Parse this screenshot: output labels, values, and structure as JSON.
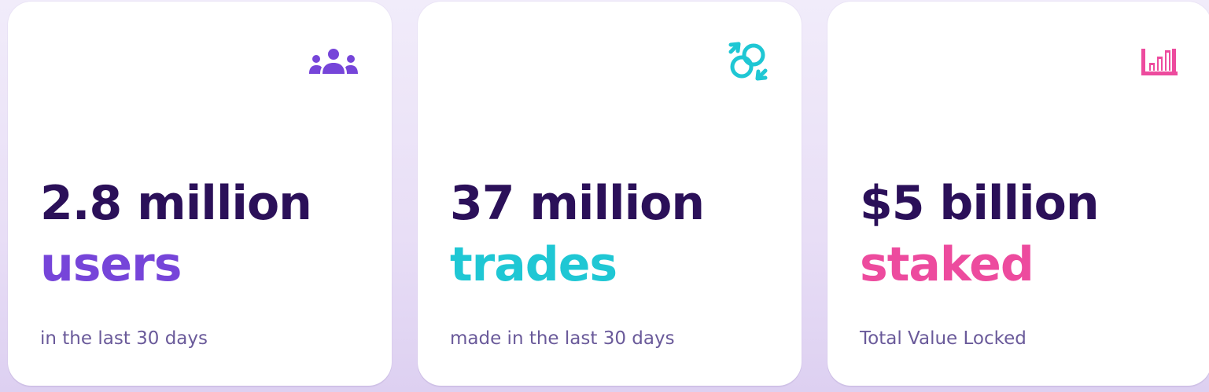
{
  "stats": [
    {
      "value": "2.8 million",
      "unit": "users",
      "caption": "in the last 30 days",
      "accent": "#7645d9",
      "icon": "users-icon"
    },
    {
      "value": "37 million",
      "unit": "trades",
      "caption": "made in the last 30 days",
      "accent": "#1fc7d4",
      "icon": "swap-icon"
    },
    {
      "value": "$5 billion",
      "unit": "staked",
      "caption": "Total Value Locked",
      "accent": "#ed4b9e",
      "icon": "chart-icon"
    }
  ],
  "colors": {
    "heading": "#2b1059",
    "caption": "#6a5a9a",
    "card": "#ffffff"
  }
}
